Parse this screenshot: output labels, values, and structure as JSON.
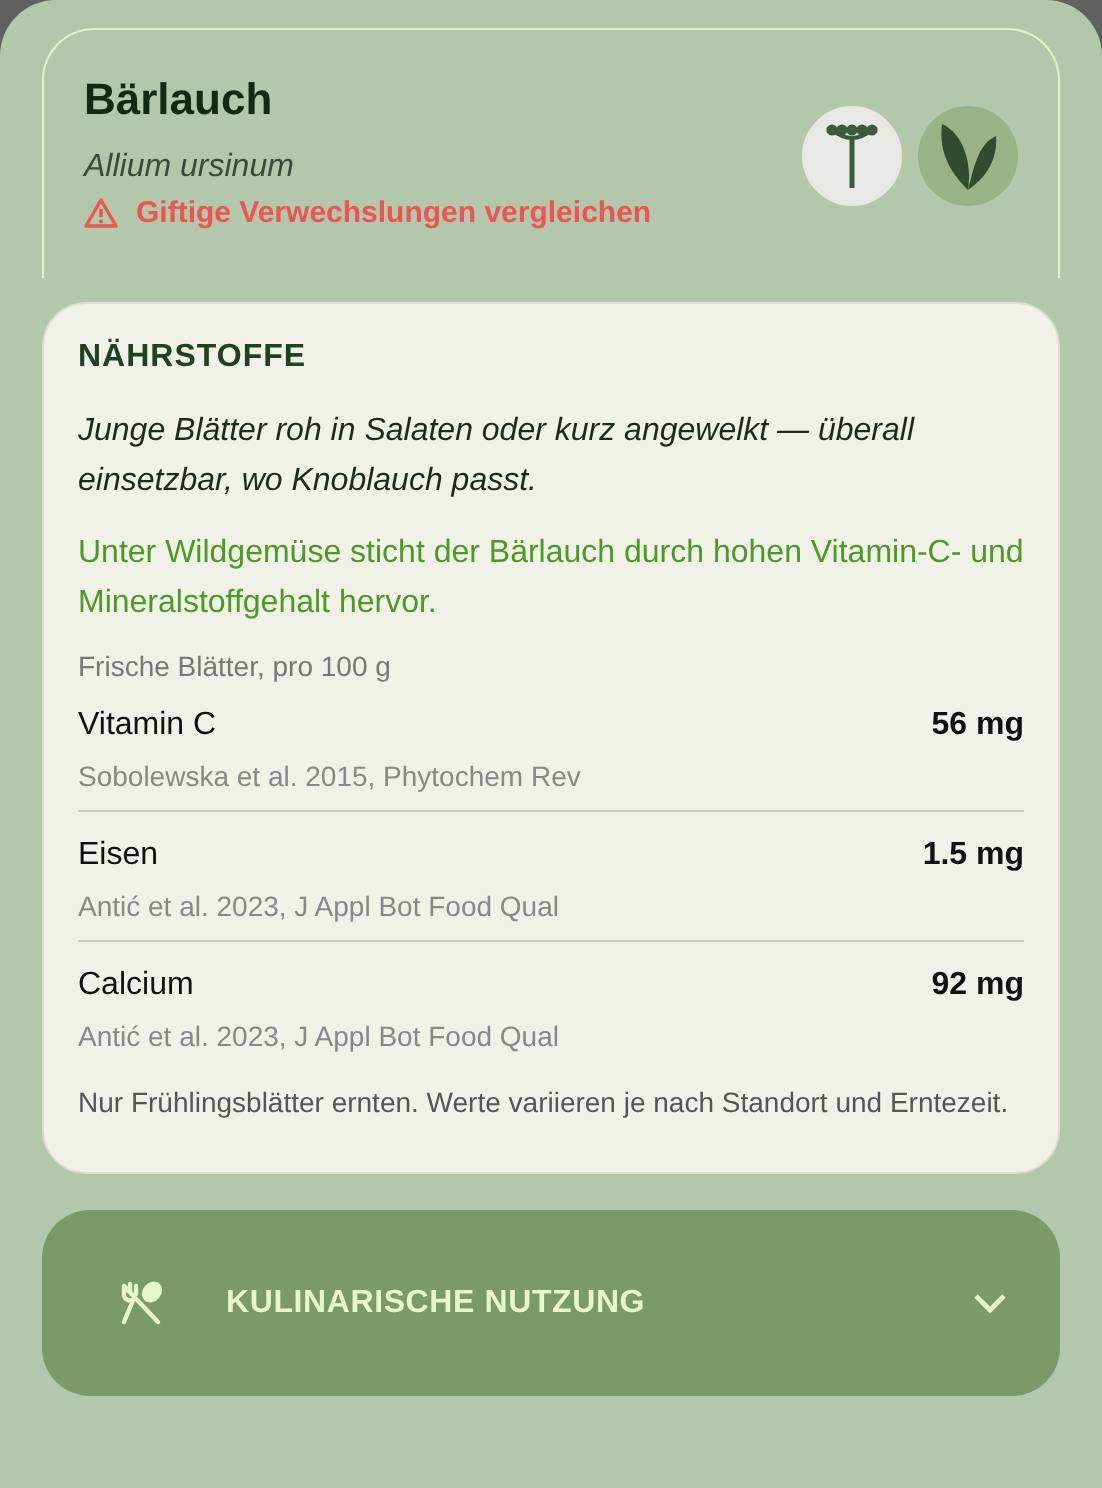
{
  "header": {
    "title": "Bärlauch",
    "latin_name": "Allium ursinum",
    "warning_link": "Giftige Verwechslungen vergleichen",
    "view_toggles": [
      {
        "kind": "flower",
        "selected": false
      },
      {
        "kind": "leaf",
        "selected": true
      }
    ]
  },
  "nutrients": {
    "heading": "NÄHRSTOFFE",
    "usage_note": "Junge Blätter roh in Salaten oder kurz angewelkt — überall einsetzbar, wo Knoblauch passt.",
    "highlight": "Unter Wildgemüse sticht der Bärlauch durch hohen Vitamin-C- und Mineralstoffgehalt hervor.",
    "basis": "Frische Blätter, pro 100 g",
    "rows": [
      {
        "name": "Vitamin C",
        "value": "56 mg",
        "source": "Sobolewska et al. 2015, Phytochem Rev"
      },
      {
        "name": "Eisen",
        "value": "1.5 mg",
        "source": "Antić et al. 2023, J Appl Bot Food Qual"
      },
      {
        "name": "Calcium",
        "value": "92 mg",
        "source": "Antić et al. 2023, J Appl Bot Food Qual"
      }
    ],
    "footnote": "Nur Frühlingsblätter ernten. Werte variieren je nach Standort und Erntezeit."
  },
  "accordion": {
    "title": "KULINARISCHE NUTZUNG",
    "expanded": false
  }
}
